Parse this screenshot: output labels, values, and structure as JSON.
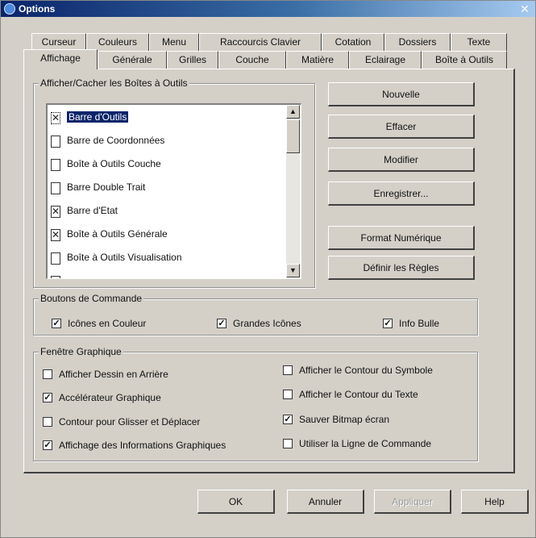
{
  "window": {
    "title": "Options",
    "close_glyph": "✕"
  },
  "tabs_row1": [
    "Curseur",
    "Couleurs",
    "Menu",
    "Raccourcis Clavier",
    "Cotation",
    "Dossiers",
    "Texte"
  ],
  "tabs_row2": [
    "Affichage",
    "Générale",
    "Grilles",
    "Couche",
    "Matière",
    "Eclairage",
    "Boîte à Outils"
  ],
  "active_tab": "Affichage",
  "toolboxes": {
    "group_label": "Afficher/Cacher les Boîtes à Outils",
    "items": [
      {
        "label": "Barre d'Outils",
        "checked": true,
        "selected": true
      },
      {
        "label": "Barre de Coordonnées",
        "checked": false,
        "selected": false
      },
      {
        "label": "Boîte à Outils Couche",
        "checked": false,
        "selected": false
      },
      {
        "label": "Barre Double Trait",
        "checked": false,
        "selected": false
      },
      {
        "label": "Barre d'Etat",
        "checked": true,
        "selected": false
      },
      {
        "label": "Boîte à Outils Générale",
        "checked": true,
        "selected": false
      },
      {
        "label": "Boîte à Outils Visualisation",
        "checked": false,
        "selected": false
      }
    ],
    "scroll_up": "▲",
    "scroll_down": "▼"
  },
  "side_buttons": {
    "new": "Nouvelle",
    "delete": "Effacer",
    "modify": "Modifier",
    "save": "Enregistrer...",
    "numeric_format": "Format Numérique",
    "define_rules": "Définir les Règles"
  },
  "command_buttons": {
    "group_label": "Boutons de Commande",
    "color_icons": {
      "label": "Icônes en Couleur",
      "checked": true
    },
    "large_icons": {
      "label": "Grandes Icônes",
      "checked": true
    },
    "tooltip": {
      "label": "Info Bulle",
      "checked": true
    }
  },
  "graphic_window": {
    "group_label": "Fenêtre Graphique",
    "left": [
      {
        "label": "Afficher Dessin en Arrière",
        "checked": false
      },
      {
        "label": "Accélérateur Graphique",
        "checked": true
      },
      {
        "label": "Contour pour Glisser et Déplacer",
        "checked": false
      },
      {
        "label": "Affichage des Informations Graphiques",
        "checked": true
      }
    ],
    "right": [
      {
        "label": "Afficher le Contour du Symbole",
        "checked": false
      },
      {
        "label": "Afficher le Contour du Texte",
        "checked": false
      },
      {
        "label": "Sauver Bitmap écran",
        "checked": true
      },
      {
        "label": "Utiliser la Ligne de Commande",
        "checked": false
      }
    ]
  },
  "footer": {
    "ok": "OK",
    "cancel": "Annuler",
    "apply": "Appliquer",
    "help": "Help"
  }
}
